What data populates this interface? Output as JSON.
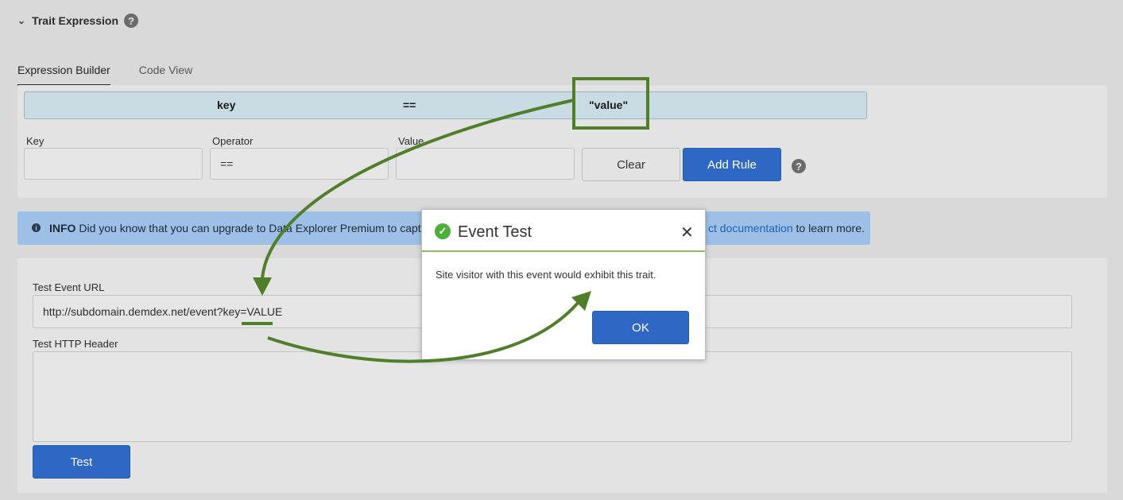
{
  "section": {
    "title": "Trait Expression",
    "collapse_icon": "chevron-down-icon",
    "help_icon": "question-icon",
    "help_glyph": "?"
  },
  "tabs": [
    {
      "label": "Expression Builder",
      "active": true
    },
    {
      "label": "Code View",
      "active": false
    }
  ],
  "expression": {
    "key": "key",
    "operator": "==",
    "value": "\"value\""
  },
  "rule_form": {
    "key_label": "Key",
    "key_value": "",
    "operator_label": "Operator",
    "operator_value": "==",
    "value_label": "Value",
    "value_value": "",
    "clear_label": "Clear",
    "add_rule_label": "Add Rule",
    "help_glyph": "?"
  },
  "info": {
    "badge": "INFO",
    "text_visible": "Did you know that you can upgrade to Data Explorer Premium to capture",
    "link_visible": "ct documentation",
    "tail": "to learn more.",
    "icon": "info-icon"
  },
  "test_panel": {
    "url_label": "Test Event URL",
    "url_value": "http://subdomain.demdex.net/event?key=VALUE",
    "header_label": "Test HTTP Header",
    "header_value": "",
    "test_label": "Test"
  },
  "modal": {
    "title": "Event Test",
    "message": "Site visitor with this event would exhibit this trait.",
    "ok_label": "OK",
    "status_icon": "check-circle-icon",
    "close_glyph": "✕"
  },
  "colors": {
    "accent": "#2f67c5",
    "annotation": "#507f2c",
    "success": "#4caf3a",
    "info_bg": "#9ebfe6"
  }
}
